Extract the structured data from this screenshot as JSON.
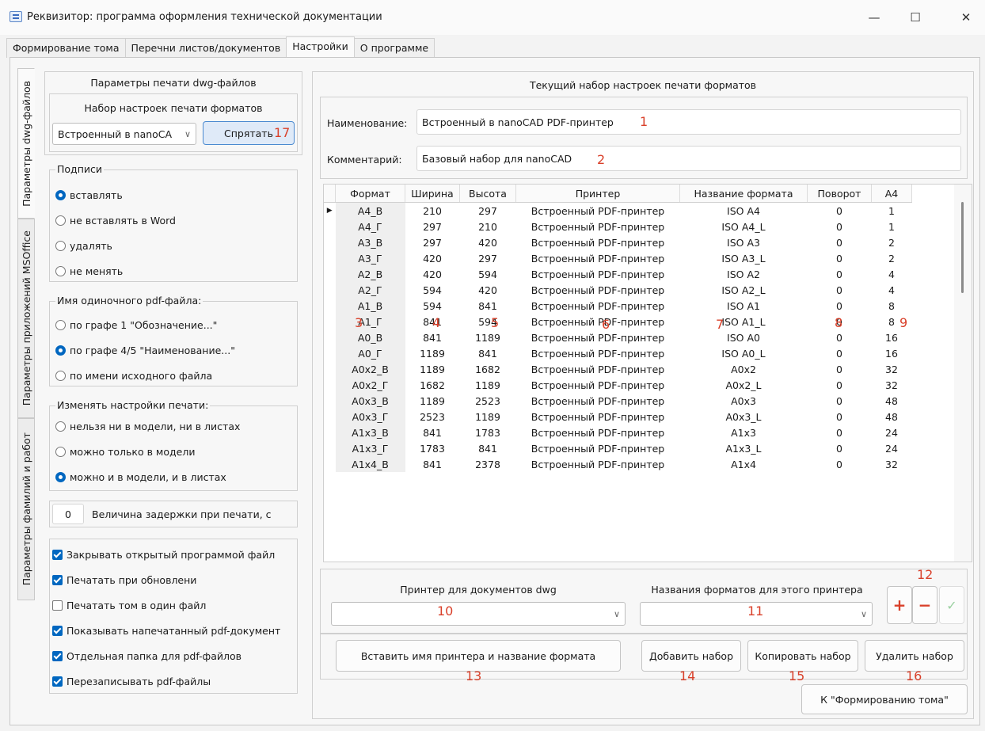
{
  "window": {
    "title": "Реквизитор: программа оформления технической документации",
    "minimize": "—",
    "maximize": "☐",
    "close": "✕"
  },
  "main_tabs": [
    "Формирование тома",
    "Перечни листов/документов",
    "Настройки",
    "О программе"
  ],
  "side_tabs": [
    "Параметры dwg-файлов",
    "Параметры приложений MSOffice",
    "Параметры фамилий и работ"
  ],
  "left": {
    "title": "Параметры печати dwg-файлов",
    "set_label": "Набор настроек печати форматов",
    "set_value": "Встроенный в nanoCA",
    "hide_button": "Спрятать",
    "signatures": {
      "title": "Подписи",
      "options": [
        "вставлять",
        "не вставлять в Word",
        "удалять",
        "не менять"
      ],
      "selected": 0
    },
    "pdf_name": {
      "title": "Имя одиночного pdf-файла:",
      "options": [
        "по графе 1 \"Обозначение...\"",
        "по графе 4/5 \"Наименование...\"",
        "по имени исходного файла"
      ],
      "selected": 1
    },
    "print_settings": {
      "title": "Изменять настройки печати:",
      "options": [
        "нельзя ни в модели, ни в листах",
        "можно только в модели",
        "можно и в модели, и в листах"
      ],
      "selected": 2
    },
    "delay_value": "0",
    "delay_label": "Величина задержки при печати, с",
    "checks": [
      {
        "label": "Закрывать открытый программой файл",
        "checked": true
      },
      {
        "label": "Печатать при обновлени",
        "checked": true
      },
      {
        "label": "Печатать том в один файл",
        "checked": false
      },
      {
        "label": "Показывать напечатанный pdf-документ",
        "checked": true
      },
      {
        "label": "Отдельная папка для pdf-файлов",
        "checked": true
      },
      {
        "label": "Перезаписывать pdf-файлы",
        "checked": true
      }
    ]
  },
  "right": {
    "title": "Текущий набор настроек печати форматов",
    "name_label": "Наименование:",
    "name_value": "Встроенный в nanoCAD PDF-принтер",
    "comment_label": "Комментарий:",
    "comment_value": "Базовый набор для nanoCAD",
    "columns": [
      "Формат",
      "Ширина",
      "Высота",
      "Принтер",
      "Название формата",
      "Поворот",
      "A4"
    ],
    "rows": [
      [
        "A4_В",
        "210",
        "297",
        "Встроенный PDF-принтер",
        "ISO A4",
        "0",
        "1"
      ],
      [
        "A4_Г",
        "297",
        "210",
        "Встроенный PDF-принтер",
        "ISO A4_L",
        "0",
        "1"
      ],
      [
        "A3_В",
        "297",
        "420",
        "Встроенный PDF-принтер",
        "ISO A3",
        "0",
        "2"
      ],
      [
        "A3_Г",
        "420",
        "297",
        "Встроенный PDF-принтер",
        "ISO A3_L",
        "0",
        "2"
      ],
      [
        "A2_В",
        "420",
        "594",
        "Встроенный PDF-принтер",
        "ISO A2",
        "0",
        "4"
      ],
      [
        "A2_Г",
        "594",
        "420",
        "Встроенный PDF-принтер",
        "ISO A2_L",
        "0",
        "4"
      ],
      [
        "A1_В",
        "594",
        "841",
        "Встроенный PDF-принтер",
        "ISO A1",
        "0",
        "8"
      ],
      [
        "A1_Г",
        "841",
        "594",
        "Встроенный PDF-принтер",
        "ISO A1_L",
        "0",
        "8"
      ],
      [
        "A0_В",
        "841",
        "1189",
        "Встроенный PDF-принтер",
        "ISO A0",
        "0",
        "16"
      ],
      [
        "A0_Г",
        "1189",
        "841",
        "Встроенный PDF-принтер",
        "ISO A0_L",
        "0",
        "16"
      ],
      [
        "A0x2_В",
        "1189",
        "1682",
        "Встроенный PDF-принтер",
        "A0x2",
        "0",
        "32"
      ],
      [
        "A0x2_Г",
        "1682",
        "1189",
        "Встроенный PDF-принтер",
        "A0x2_L",
        "0",
        "32"
      ],
      [
        "A0x3_В",
        "1189",
        "2523",
        "Встроенный PDF-принтер",
        "A0x3",
        "0",
        "48"
      ],
      [
        "A0x3_Г",
        "2523",
        "1189",
        "Встроенный PDF-принтер",
        "A0x3_L",
        "0",
        "48"
      ],
      [
        "A1x3_В",
        "841",
        "1783",
        "Встроенный PDF-принтер",
        "A1x3",
        "0",
        "24"
      ],
      [
        "A1x3_Г",
        "1783",
        "841",
        "Встроенный PDF-принтер",
        "A1x3_L",
        "0",
        "24"
      ],
      [
        "A1x4_В",
        "841",
        "2378",
        "Встроенный PDF-принтер",
        "A1x4",
        "0",
        "32"
      ]
    ],
    "printer_label": "Принтер для документов dwg",
    "formats_label": "Названия форматов для этого принтера",
    "plus": "+",
    "minus": "−",
    "ok": "✓",
    "insert_button": "Вставить имя принтера и название формата",
    "add_button": "Добавить набор",
    "copy_button": "Копировать набор",
    "delete_button": "Удалить набор",
    "goto_button": "К \"Формированию тома\""
  },
  "annotations": [
    "1",
    "2",
    "3",
    "4",
    "5",
    "6",
    "7",
    "8",
    "9",
    "10",
    "11",
    "12",
    "13",
    "14",
    "15",
    "16",
    "17"
  ],
  "colors": {
    "accent": "#0067c0",
    "annotation": "#d9402a"
  }
}
